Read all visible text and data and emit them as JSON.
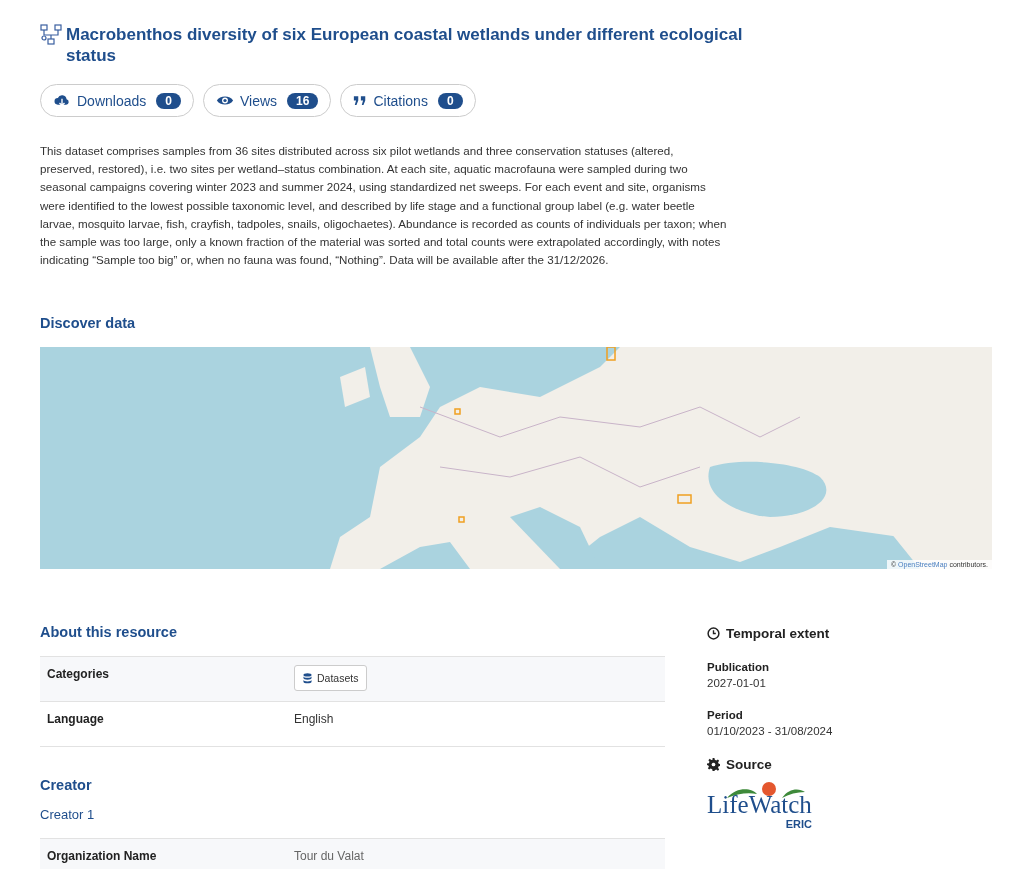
{
  "title": "Macrobenthos diversity of six European coastal wetlands under different ecological status",
  "stats": [
    {
      "kind": "downloads",
      "label": "Downloads",
      "count": "0"
    },
    {
      "kind": "views",
      "label": "Views",
      "count": "16"
    },
    {
      "kind": "citations",
      "label": "Citations",
      "count": "0"
    }
  ],
  "description": "This dataset comprises samples from 36 sites distributed across six pilot wetlands and three conservation statuses (altered, preserved, restored), i.e. two sites per wetland–status combination. At each site, aquatic macrofauna were sampled during two seasonal campaigns covering winter 2023 and summer 2024, using standardized net sweeps. For each event and site, organisms were identified to the lowest possible taxonomic level, and described by life stage and a functional group label (e.g. water beetle larvae, mosquito larvae, fish, crayfish, tadpoles, snails, oligochaetes). Abundance is recorded as counts of individuals per taxon; when the sample was too large, only a known fraction of the material was sorted and total counts were extrapolated accordingly, with notes indicating “Sample too big” or, when no fauna was found, “Nothing”. Data will be available after the 31/12/2026.",
  "discover": {
    "heading": "Discover data",
    "map": {
      "kind": "picture",
      "attribution": {
        "symbol": "©",
        "link": "OpenStreetMap",
        "text": "contributors."
      }
    }
  },
  "about": {
    "heading": "About this resource",
    "rows": [
      {
        "label": "Categories",
        "kind": "tag",
        "value": "Datasets"
      },
      {
        "label": "Language",
        "kind": "text",
        "value": "English"
      }
    ]
  },
  "creator": {
    "heading": "Creator",
    "subheading": "Creator 1",
    "rows": [
      {
        "label": "Organization Name",
        "value": "Tour du Valat"
      }
    ]
  },
  "temporal": {
    "heading": "Temporal extent",
    "items": [
      {
        "label": "Publication",
        "value": "2027-01-01"
      },
      {
        "label": "Period",
        "value": "01/10/2023 - 31/08/2024"
      }
    ]
  },
  "source": {
    "heading": "Source",
    "logo": {
      "name": "LifeWatch",
      "sub": "ERIC"
    }
  }
}
